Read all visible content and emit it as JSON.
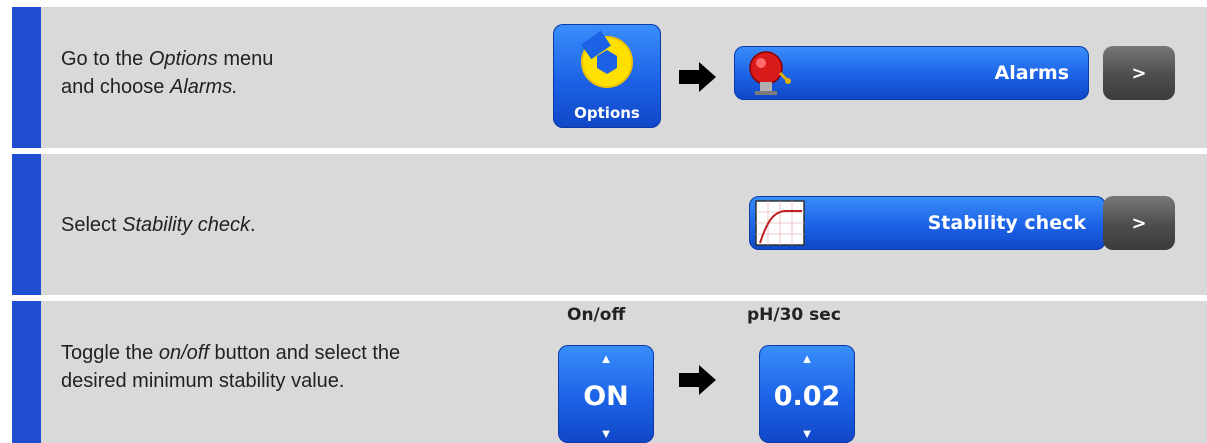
{
  "steps": [
    {
      "text": [
        "Go to the ",
        "Options",
        " menu",
        "and choose ",
        "Alarms."
      ],
      "options_tile_label": "Options",
      "menu_label": "Alarms",
      "next_label": ">"
    },
    {
      "text": [
        "Select ",
        "Stability check",
        "."
      ],
      "menu_label": "Stability check",
      "next_label": ">"
    },
    {
      "text": [
        "Toggle the ",
        "on/off",
        " button and select the",
        "desired minimum stability value."
      ],
      "toggle": {
        "title": "On/off",
        "value": "ON"
      },
      "stability": {
        "title": "pH/30 sec",
        "value": "0.02"
      }
    }
  ],
  "colors": {
    "accent": "#1f4fd0",
    "row_bg": "#d9d9d9",
    "button_blue": "#1c62e6",
    "button_gray": "#4d4d4d"
  },
  "icons": [
    "wrench-icon",
    "arrow-right-icon",
    "alarm-bell-icon",
    "stability-graph-icon",
    "chevron-up-icon",
    "chevron-down-icon"
  ]
}
